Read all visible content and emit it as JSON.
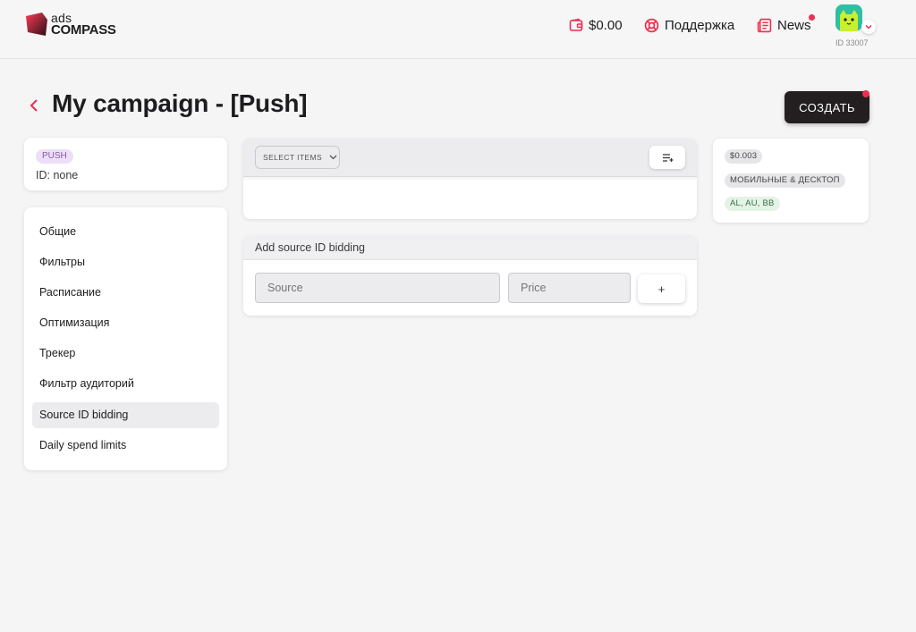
{
  "header": {
    "logo_top": "ads",
    "logo_bottom": "COMPASS",
    "balance": "$0.00",
    "support": "Поддержка",
    "news": "News",
    "user_id": "ID 33007"
  },
  "page": {
    "title": "My campaign - [Push]",
    "create_label": "СОЗДАТЬ"
  },
  "info": {
    "type_badge": "PUSH",
    "id_text": "ID: none"
  },
  "menu": {
    "items": [
      {
        "label": "Общие"
      },
      {
        "label": "Фильтры"
      },
      {
        "label": "Расписание"
      },
      {
        "label": "Оптимизация"
      },
      {
        "label": "Трекер"
      },
      {
        "label": "Фильтр аудиторий"
      },
      {
        "label": "Source ID bidding",
        "active": true
      },
      {
        "label": "Daily spend limits"
      }
    ]
  },
  "selector": {
    "select_label": "SELECT ITEMS"
  },
  "bidding": {
    "header": "Add source ID bidding",
    "source_placeholder": "Source",
    "price_placeholder": "Price",
    "add_label": "+"
  },
  "summary": {
    "price": "$0.003",
    "device": "МОБИЛЬНЫЕ & ДЕСКТОП",
    "geo": "AL, AU, BB"
  },
  "colors": {
    "accent": "#ef2d4f",
    "dark_button": "#231f20",
    "background": "#f5f5f5"
  }
}
